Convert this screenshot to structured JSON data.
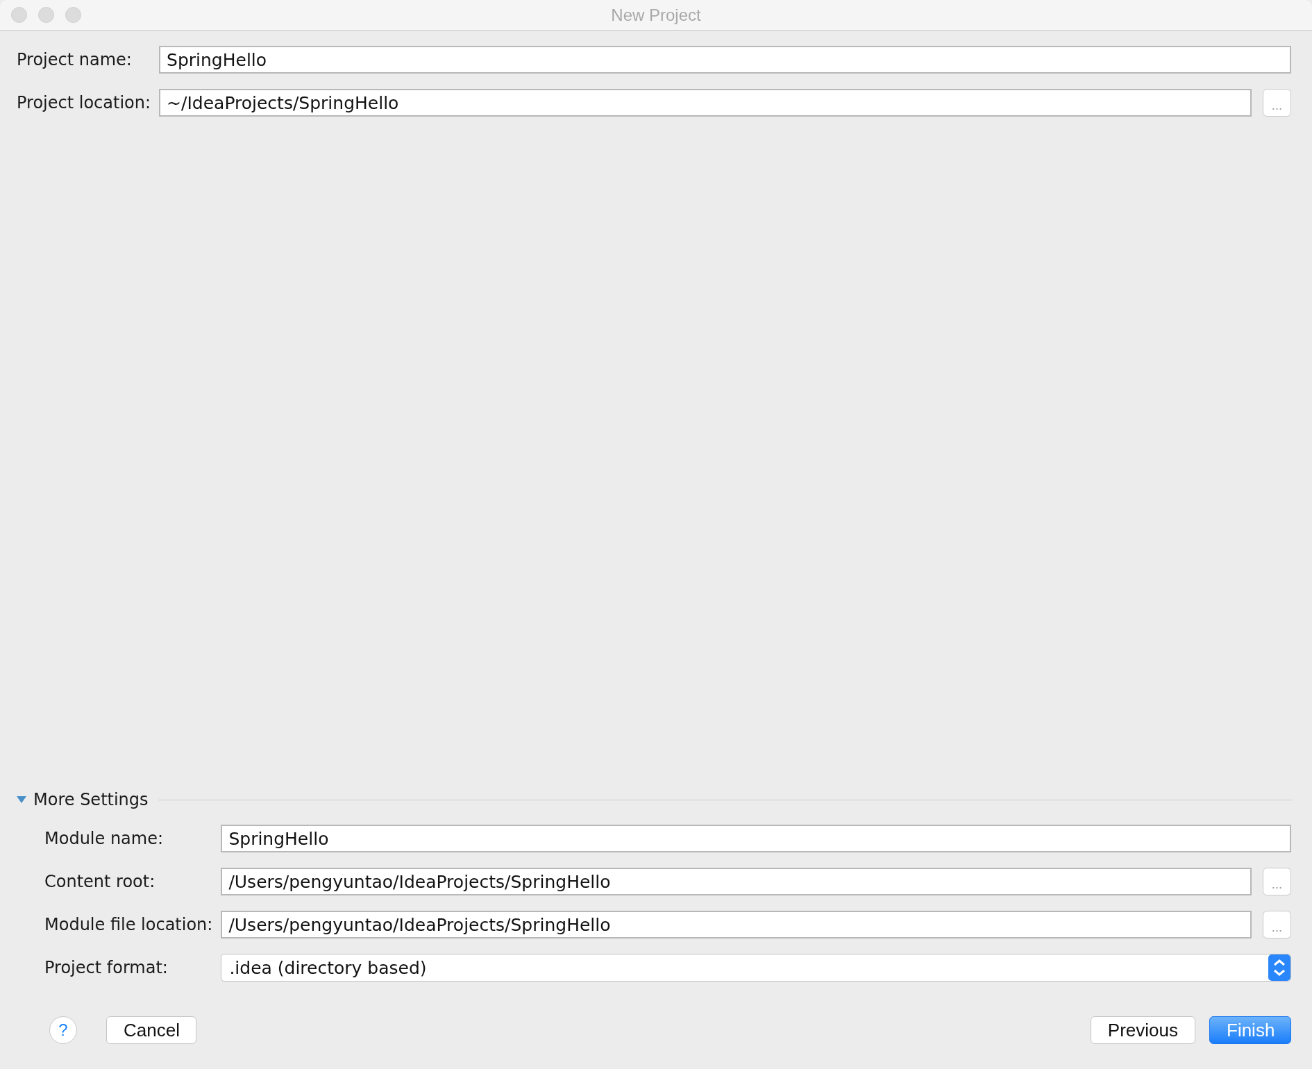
{
  "window": {
    "title": "New Project"
  },
  "project_fields": [
    {
      "label": "Project name:",
      "kind": "text",
      "value": "SpringHello"
    },
    {
      "label": "Project location:",
      "kind": "path",
      "value": "~/IdeaProjects/SpringHello",
      "browse": "..."
    }
  ],
  "more_settings": {
    "title": "More Settings",
    "expanded": true,
    "fields": [
      {
        "label": "Module name:",
        "kind": "text",
        "value": "SpringHello"
      },
      {
        "label": "Content root:",
        "kind": "path",
        "value": "/Users/pengyuntao/IdeaProjects/SpringHello",
        "browse": "..."
      },
      {
        "label": "Module file location:",
        "kind": "path",
        "value": "/Users/pengyuntao/IdeaProjects/SpringHello",
        "browse": "..."
      },
      {
        "label": "Project format:",
        "kind": "select",
        "value": ".idea (directory based)"
      }
    ]
  },
  "footer": {
    "help": "?",
    "cancel": "Cancel",
    "previous": "Previous",
    "finish": "Finish"
  }
}
